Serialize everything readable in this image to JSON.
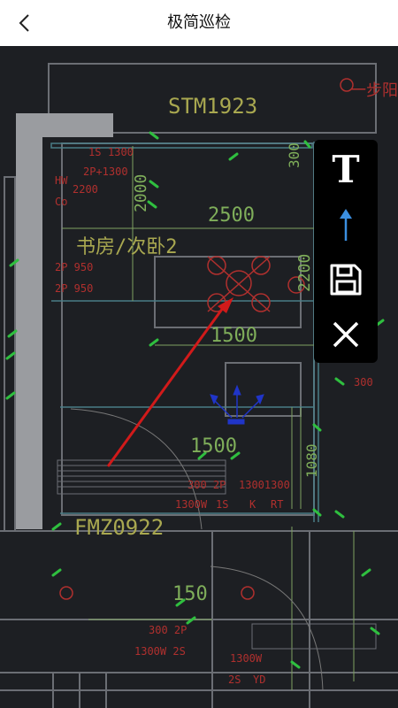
{
  "header": {
    "title": "极简巡检"
  },
  "toolbar": {
    "text_tool_label": "T",
    "arrow_color": "#3b8fe0"
  },
  "drawing": {
    "labels": {
      "room_code": "STM1923",
      "room_name": "书房/次卧2",
      "dim_2500": "2500",
      "dim_1500_a": "1500",
      "dim_1500_b": "1500",
      "dim_150": "150",
      "door_code": "FMZ0922",
      "dim_2200": "2200",
      "dim_2000": "2000",
      "dim_1080": "1080",
      "dim_300": "300",
      "tag_1s": "1S",
      "val_1300": "1300",
      "tag_2p": "2P+1300",
      "tag_hw": "HW",
      "val_2200": "2200",
      "tag_co": "Co",
      "tag_2p_950_a": "2P 950",
      "tag_2p_950_b": "2P 950",
      "val_300_2p": "300 2P",
      "val_13001300": "13001300",
      "val_1300w": "1300W",
      "tag_1s_b": "1S",
      "tag_k": "K",
      "tag_rt": "RT",
      "val_300_2p_b": "300 2P",
      "val_1300w_2s": "1300W 2S",
      "val_1300w_b": "1300W",
      "tag_2s": "2S",
      "tag_yd": "YD",
      "val_300_right": "300",
      "corner_text": "一步阳"
    }
  }
}
